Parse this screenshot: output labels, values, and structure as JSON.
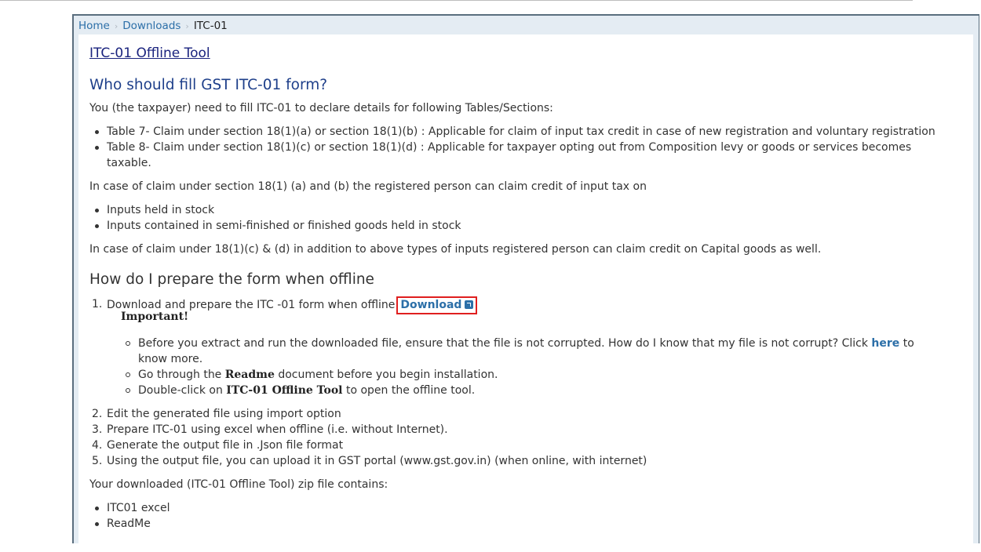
{
  "breadcrumb": {
    "home": "Home",
    "downloads": "Downloads",
    "current": "ITC-01",
    "separator": "›"
  },
  "title": "ITC-01 Offline Tool",
  "who_heading": "Who should fill GST ITC-01 form?",
  "intro": "You (the taxpayer) need to fill ITC-01 to declare details for following Tables/Sections:",
  "tables": [
    "Table 7- Claim under section 18(1)(a) or section 18(1)(b) : Applicable for claim of input tax credit in case of new registration and voluntary registration",
    "Table 8- Claim under section 18(1)(c) or section 18(1)(d) : Applicable for taxpayer opting out from Composition levy or goods or services becomes",
    "taxable."
  ],
  "claim_ab_text": "In case of claim under section 18(1) (a) and (b) the registered person can claim credit of input tax on",
  "claim_ab_items": [
    "Inputs held in stock",
    "Inputs contained in semi-finished or finished goods held in stock"
  ],
  "claim_cd_text": "In case of claim under 18(1)(c) & (d) in addition to above types of inputs registered person can claim credit on Capital goods as well.",
  "how_heading": "How do I prepare the form when offline",
  "step1": {
    "num": "1.",
    "text": "Download and prepare the ITC -01 form when offline",
    "download_label": "Download",
    "icon": "external-link-icon"
  },
  "important_label": "Important!",
  "important_items": {
    "item1_text": "Before you extract and run the downloaded file, ensure that the file is not corrupted. How do I know that my file is not corrupt? Click",
    "item1_link": "here",
    "item1_after": "to",
    "item1_line2": "know more.",
    "item2_before": "Go through the",
    "item2_bold": "Readme",
    "item2_after": "document before you begin installation.",
    "item3_before": "Double-click on",
    "item3_bold": "ITC-01 Offline Tool",
    "item3_after": "to open the offline tool."
  },
  "steps_rest": [
    {
      "num": "2.",
      "text": "Edit the generated file using import option"
    },
    {
      "num": "3.",
      "text": "Prepare ITC-01 using excel when offline (i.e. without Internet)."
    },
    {
      "num": "4.",
      "text": "Generate the output file in .Json file format"
    },
    {
      "num": "5.",
      "text": "Using the output file, you can upload it in GST portal (www.gst.gov.in) (when online, with internet)"
    }
  ],
  "zip_text": "Your downloaded (ITC-01 Offline Tool) zip file contains:",
  "zip_items": [
    "ITC01 excel",
    "ReadMe"
  ],
  "colors": {
    "link": "#2c6fa8",
    "title": "#1a237e",
    "highlight_box": "#e01f1f",
    "frame_bg": "#e4ecf3"
  }
}
